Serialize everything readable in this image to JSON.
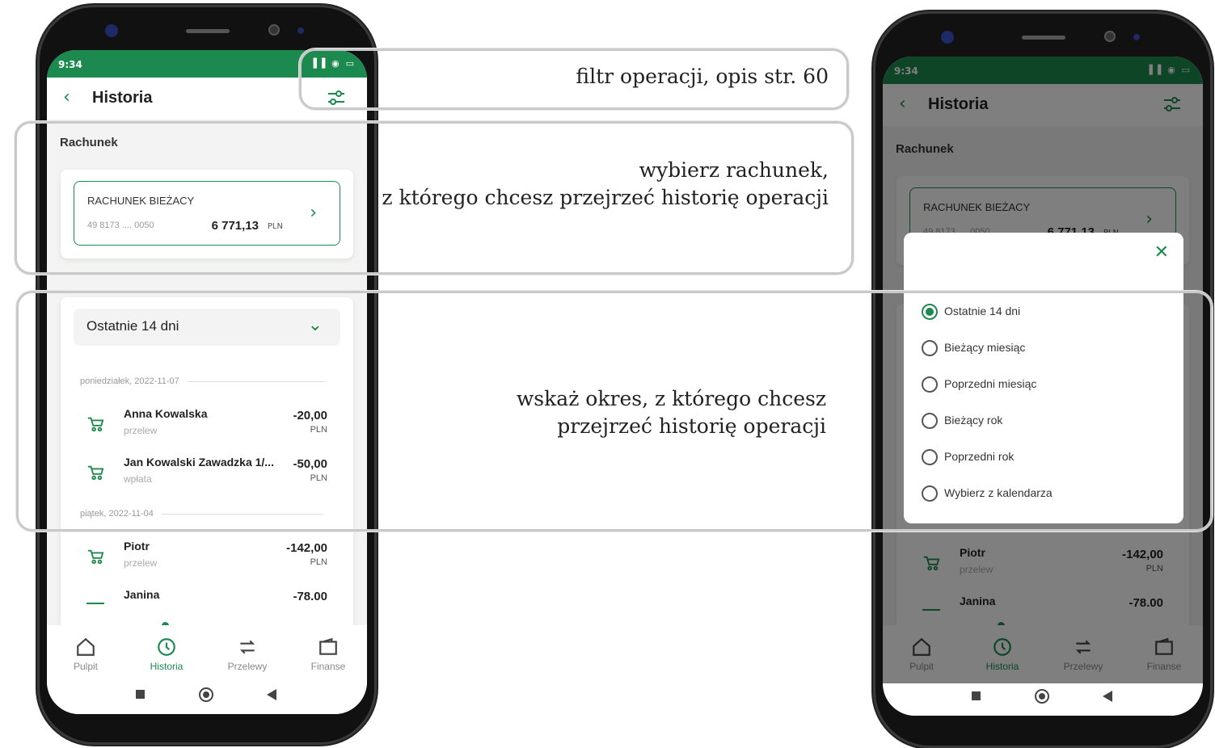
{
  "colors": {
    "brand": "#1c8a4e",
    "text": "#222222",
    "muted": "#999999"
  },
  "statusbar": {
    "time": "9:34",
    "icons": "▐▐ ◉ ▭"
  },
  "header": {
    "title": "Historia",
    "back_icon": "chevron-left-icon",
    "filter_icon": "sliders-icon"
  },
  "account_section": {
    "label": "Rachunek",
    "account": {
      "name": "RACHUNEK BIEŻACY",
      "number": "49 8173 .... 0050",
      "balance": "6 771,13",
      "currency": "PLN"
    }
  },
  "period_select": {
    "value": "Ostatnie 14 dni"
  },
  "transactions": {
    "groups": [
      {
        "date": "poniedziałek, 2022-11-07",
        "items": [
          {
            "name": "Anna Kowalska",
            "type": "przelew",
            "amount": "-20,00",
            "currency": "PLN"
          },
          {
            "name": "Jan Kowalski Zawadzka 1/...",
            "type": "wpłata",
            "amount": "-50,00",
            "currency": "PLN"
          }
        ]
      },
      {
        "date": "piątek, 2022-11-04",
        "items": [
          {
            "name": "Piotr",
            "type": "przelew",
            "amount": "-142,00",
            "currency": "PLN"
          },
          {
            "name": "Janina",
            "type": "",
            "amount": "-78.00",
            "currency": ""
          }
        ]
      }
    ]
  },
  "bottom_nav": {
    "items": [
      {
        "label": "Pulpit",
        "icon": "home-icon"
      },
      {
        "label": "Historia",
        "icon": "history-icon"
      },
      {
        "label": "Przelewy",
        "icon": "transfer-icon"
      },
      {
        "label": "Finanse",
        "icon": "wallet-icon"
      }
    ],
    "active": "Historia"
  },
  "annotations": {
    "filter": "filtr operacji, opis str. 60",
    "account_line1": "wybierz rachunek,",
    "account_line2": "z którego chcesz przejrzeć historię operacji",
    "period_line1": "wskaż okres, z którego chcesz",
    "period_line2": "przejrzeć historię operacji"
  },
  "period_modal": {
    "close_icon": "close-icon",
    "selected": "Ostatnie 14 dni",
    "options": [
      "Ostatnie 14 dni",
      "Bieżący miesiąc",
      "Poprzedni miesiąc",
      "Bieżący rok",
      "Poprzedni rok",
      "Wybierz z kalendarza"
    ]
  }
}
